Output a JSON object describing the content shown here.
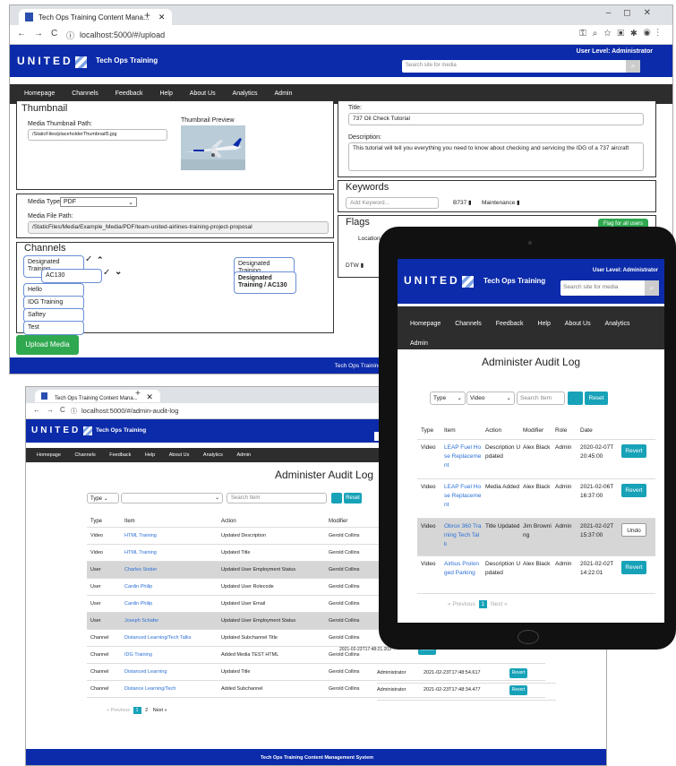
{
  "win1": {
    "tab_title": "Tech Ops Training Content Mana...",
    "url": "localhost:5000/#/upload",
    "brand": "UNITED",
    "site_title": "Tech Ops Training",
    "user_level": "User Level: Administrator",
    "search_placeholder": "Search site for media",
    "menu": [
      "Homepage",
      "Channels",
      "Feedback",
      "Help",
      "About Us",
      "Analytics",
      "Admin"
    ],
    "thumbnail": {
      "heading": "Thumbnail",
      "path_label": "Media Thumbnail Path:",
      "path_value": "/StaticFiles/placeholderThumbnail5.jpg",
      "preview_label": "Thumbnail Preview"
    },
    "media": {
      "type_label": "Media Type:",
      "type_value": "PDF",
      "file_label": "Media File Path:",
      "file_value": "/StaticFiles/Media/Example_Media/PDF/team-united-airlines-training-project-proposal"
    },
    "channels": {
      "heading": "Channels",
      "left": [
        "Designated Training",
        "AC130",
        "Hello",
        "IDG Training",
        "Saftey",
        "Test"
      ],
      "right": [
        "Designated Training",
        "Designated Training / AC130"
      ]
    },
    "upload_label": "Upload Media",
    "title_label": "Title:",
    "title_value": "737 Oil Check Tutorial",
    "desc_label": "Description:",
    "desc_value": "This tutorial will tell you everything you need to know about checking and servicing the IDG of a 737 aircraft",
    "keywords": {
      "heading": "Keywords",
      "placeholder": "Add Keyword...",
      "items": [
        "B737",
        "Maintenance"
      ]
    },
    "flags": {
      "heading": "Flags",
      "flag_all": "Flag for all users",
      "location": "Location",
      "dtw": "DTW"
    },
    "footer": "Tech Ops Training Content Management"
  },
  "win2": {
    "tab_title": "Tech Ops Training Content Mana...",
    "url": "localhost:5000/#/admin-audit-log",
    "brand": "UNITED",
    "site_title": "Tech Ops Training",
    "menu": [
      "Homepage",
      "Channels",
      "Feedback",
      "Help",
      "About Us",
      "Analytics",
      "Admin"
    ],
    "heading": "Administer Audit Log",
    "type_select": "Type",
    "search_placeholder": "Search Item",
    "reset": "Reset",
    "columns": [
      "Type",
      "Item",
      "Action",
      "Modifier"
    ],
    "rows": [
      {
        "type": "Video",
        "item": "HTML Training",
        "action": "Updated Description",
        "modifier": "Gerold Collins",
        "shade": false
      },
      {
        "type": "Video",
        "item": "HTML Training",
        "action": "Updated Title",
        "modifier": "Gerold Collins",
        "shade": false
      },
      {
        "type": "User",
        "item": "Charles Snider",
        "action": "Updated User Employment Status",
        "modifier": "Gerold Collins",
        "shade": true
      },
      {
        "type": "User",
        "item": "Cardin Philip",
        "action": "Updated User Rolecode",
        "modifier": "Gerold Collins",
        "shade": false
      },
      {
        "type": "User",
        "item": "Cardin Philip",
        "action": "Updated User Email",
        "modifier": "Gerold Collins",
        "shade": false
      },
      {
        "type": "User",
        "item": "Joseph Schafer",
        "action": "Updated User Employment Status",
        "modifier": "Gerold Collins",
        "shade": true
      },
      {
        "type": "Channel",
        "item": "Distanced Learning/Tech Talks",
        "action": "Updated Subchannel Title",
        "modifier": "Gerold Collins",
        "shade": false
      },
      {
        "type": "Channel",
        "item": "IDG Training",
        "action": "Added Media TEST HTML",
        "modifier": "Gerold Collins",
        "shade": false
      },
      {
        "type": "Channel",
        "item": "Distanced Learning",
        "action": "Updated Title",
        "modifier": "Gerold Collins",
        "shade": false
      },
      {
        "type": "Channel",
        "item": "Distance Learning/Tech",
        "action": "Added Subchannel",
        "modifier": "Gerold Collins",
        "shade": false
      }
    ],
    "extra_rows": [
      {
        "role": "Administrator",
        "date": "2021-02-23T17:48:54.617",
        "btn": "Revert"
      },
      {
        "role": "Administrator",
        "date": "2021-02-23T17:48:34.477",
        "btn": "Revert"
      }
    ],
    "partial_row": {
      "role": "Administrator",
      "date": "2021-02-23T17:48:21.203",
      "btn": "Revert"
    },
    "pager": {
      "prev": "« Previous",
      "pages": [
        "1",
        "2"
      ],
      "next": "Next »"
    },
    "footer": "Tech Ops Training Content Management System"
  },
  "tablet": {
    "brand": "UNITED",
    "site_title": "Tech Ops Training",
    "user_level": "User Level: Administrator",
    "search_placeholder": "Search site for media",
    "menu": [
      "Homepage",
      "Channels",
      "Feedback",
      "Help",
      "About Us",
      "Analytics",
      "Admin"
    ],
    "heading": "Administer Audit Log",
    "type_select": "Type",
    "media_select": "Video",
    "search_placeholder2": "Search Item",
    "reset": "Reset",
    "columns": [
      "Type",
      "Item",
      "Action",
      "Modifier",
      "Role",
      "Date"
    ],
    "rows": [
      {
        "type": "Video",
        "item": "LEAP Fuel Hose Replacement",
        "action": "Description Updated",
        "modifier": "Alex Black",
        "role": "Admin",
        "date": "2020-02-07T20:45:00",
        "btn": "Revert",
        "shade": false
      },
      {
        "type": "Video",
        "item": "LEAP Fuel Hose Replacement",
        "action": "Media Added",
        "modifier": "Alex Black",
        "role": "Admin",
        "date": "2021-02-06T16:37:00",
        "btn": "Revert",
        "shade": false
      },
      {
        "type": "Video",
        "item": "Obrox 360 Training Tech Talk",
        "action": "Title Updated",
        "modifier": "Jim Browning",
        "role": "Admin",
        "date": "2021-02-02T15:37:00",
        "btn": "Undo",
        "shade": true
      },
      {
        "type": "Video",
        "item": "Airbus Prolonged Parking",
        "action": "Description Updated",
        "modifier": "Alex Black",
        "role": "Admin",
        "date": "2021-02-02T14:22:01",
        "btn": "Revert",
        "shade": false
      }
    ],
    "pager": {
      "prev": "« Previous",
      "page": "1",
      "next": "Next »"
    }
  },
  "colors": {
    "united_blue": "#0c2baa",
    "menu_dark": "#2d2d2d",
    "teal": "#17a2b8",
    "green": "#2fa84f",
    "link": "#2a6fd6"
  }
}
